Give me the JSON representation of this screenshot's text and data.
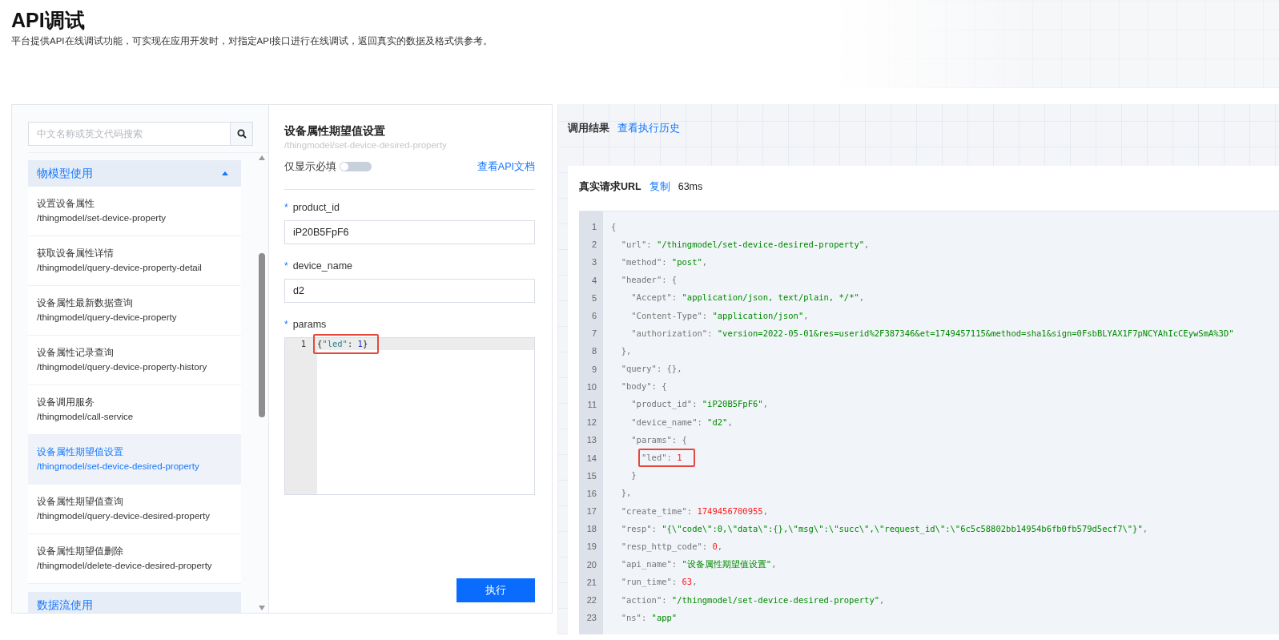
{
  "header": {
    "title": "API调试",
    "description": "平台提供API在线调试功能，可实现在应用开发时，对指定API接口进行在线调试，返回真实的数据及格式供参考。"
  },
  "sidebar": {
    "search": {
      "placeholder": "中文名称或英文代码搜索"
    },
    "groups": [
      {
        "label": "物模型使用",
        "expanded": true,
        "items": [
          {
            "name": "设置设备属性",
            "path": "/thingmodel/set-device-property",
            "selected": false
          },
          {
            "name": "获取设备属性详情",
            "path": "/thingmodel/query-device-property-detail",
            "selected": false
          },
          {
            "name": "设备属性最新数据查询",
            "path": "/thingmodel/query-device-property",
            "selected": false
          },
          {
            "name": "设备属性记录查询",
            "path": "/thingmodel/query-device-property-history",
            "selected": false
          },
          {
            "name": "设备调用服务",
            "path": "/thingmodel/call-service",
            "selected": false
          },
          {
            "name": "设备属性期望值设置",
            "path": "/thingmodel/set-device-desired-property",
            "selected": true
          },
          {
            "name": "设备属性期望值查询",
            "path": "/thingmodel/query-device-desired-property",
            "selected": false
          },
          {
            "name": "设备属性期望值删除",
            "path": "/thingmodel/delete-device-desired-property",
            "selected": false
          }
        ]
      },
      {
        "label": "数据流使用"
      }
    ]
  },
  "form": {
    "title": "设备属性期望值设置",
    "path": "/thingmodel/set-device-desired-property",
    "required_only": {
      "label": "仅显示必填",
      "on": false
    },
    "doc_link": "查看API文档",
    "fields": [
      {
        "mark": "*",
        "label": "product_id",
        "value": "iP20B5FpF6"
      },
      {
        "mark": "*",
        "label": "device_name",
        "value": "d2"
      }
    ],
    "params": {
      "mark": "*",
      "label": "params",
      "lines": [
        {
          "number": "1",
          "boxed": true,
          "tokens": [
            {
              "kind": "brace",
              "text": "{"
            },
            {
              "kind": "key",
              "text": "\"led\""
            },
            {
              "kind": "brace",
              "text": ": "
            },
            {
              "kind": "number",
              "text": "1"
            },
            {
              "kind": "brace",
              "text": "}"
            }
          ]
        }
      ]
    },
    "submit": "执行"
  },
  "result": {
    "title": "调用结果",
    "history_link": "查看执行历史",
    "request_url": {
      "label": "真实请求URL",
      "copy": "复制",
      "duration": "63ms"
    },
    "code": {
      "lines": [
        {
          "number": "1",
          "tokens": [
            {
              "kind": "plain",
              "text": "{"
            }
          ]
        },
        {
          "number": "2",
          "tokens": [
            {
              "kind": "plain",
              "text": "  \"url\": "
            },
            {
              "kind": "string",
              "text": "\"/thingmodel/set-device-desired-property\""
            },
            {
              "kind": "plain",
              "text": ","
            }
          ]
        },
        {
          "number": "3",
          "tokens": [
            {
              "kind": "plain",
              "text": "  \"method\": "
            },
            {
              "kind": "string",
              "text": "\"post\""
            },
            {
              "kind": "plain",
              "text": ","
            }
          ]
        },
        {
          "number": "4",
          "tokens": [
            {
              "kind": "plain",
              "text": "  \"header\": {"
            }
          ]
        },
        {
          "number": "5",
          "tokens": [
            {
              "kind": "plain",
              "text": "    \"Accept\": "
            },
            {
              "kind": "string",
              "text": "\"application/json, text/plain, */*\""
            },
            {
              "kind": "plain",
              "text": ","
            }
          ]
        },
        {
          "number": "6",
          "tokens": [
            {
              "kind": "plain",
              "text": "    \"Content-Type\": "
            },
            {
              "kind": "string",
              "text": "\"application/json\""
            },
            {
              "kind": "plain",
              "text": ","
            }
          ]
        },
        {
          "number": "7",
          "tokens": [
            {
              "kind": "plain",
              "text": "    \"authorization\": "
            },
            {
              "kind": "string",
              "text": "\"version=2022-05-01&res=userid%2F387346&et=1749457115&method=sha1&sign=0FsbBLYAX1F7pNCYAhIcCEywSmA%3D\""
            }
          ]
        },
        {
          "number": "8",
          "tokens": [
            {
              "kind": "plain",
              "text": "  },"
            }
          ]
        },
        {
          "number": "9",
          "tokens": [
            {
              "kind": "plain",
              "text": "  \"query\": {},"
            }
          ]
        },
        {
          "number": "10",
          "tokens": [
            {
              "kind": "plain",
              "text": "  \"body\": {"
            }
          ]
        },
        {
          "number": "11",
          "tokens": [
            {
              "kind": "plain",
              "text": "    \"product_id\": "
            },
            {
              "kind": "string",
              "text": "\"iP20B5FpF6\""
            },
            {
              "kind": "plain",
              "text": ","
            }
          ]
        },
        {
          "number": "12",
          "tokens": [
            {
              "kind": "plain",
              "text": "    \"device_name\": "
            },
            {
              "kind": "string",
              "text": "\"d2\""
            },
            {
              "kind": "plain",
              "text": ","
            }
          ]
        },
        {
          "number": "13",
          "tokens": [
            {
              "kind": "plain",
              "text": "    \"params\": {"
            }
          ]
        },
        {
          "number": "14",
          "boxed": true,
          "tokens": [
            {
              "kind": "plain",
              "text": "      \"led\": "
            },
            {
              "kind": "number",
              "text": "1"
            }
          ]
        },
        {
          "number": "15",
          "tokens": [
            {
              "kind": "plain",
              "text": "    }"
            }
          ]
        },
        {
          "number": "16",
          "tokens": [
            {
              "kind": "plain",
              "text": "  },"
            }
          ]
        },
        {
          "number": "17",
          "tokens": [
            {
              "kind": "plain",
              "text": "  \"create_time\": "
            },
            {
              "kind": "number",
              "text": "1749456700955"
            },
            {
              "kind": "plain",
              "text": ","
            }
          ]
        },
        {
          "number": "18",
          "tokens": [
            {
              "kind": "plain",
              "text": "  \"resp\": "
            },
            {
              "kind": "string",
              "text": "\"{\\\"code\\\":0,\\\"data\\\":{},\\\"msg\\\":\\\"succ\\\",\\\"request_id\\\":\\\"6c5c58802bb14954b6fb0fb579d5ecf7\\\"}\""
            },
            {
              "kind": "plain",
              "text": ","
            }
          ]
        },
        {
          "number": "19",
          "tokens": [
            {
              "kind": "plain",
              "text": "  \"resp_http_code\": "
            },
            {
              "kind": "number",
              "text": "0"
            },
            {
              "kind": "plain",
              "text": ","
            }
          ]
        },
        {
          "number": "20",
          "tokens": [
            {
              "kind": "plain",
              "text": "  \"api_name\": "
            },
            {
              "kind": "string",
              "text": "\"设备属性期望值设置\""
            },
            {
              "kind": "plain",
              "text": ","
            }
          ]
        },
        {
          "number": "21",
          "tokens": [
            {
              "kind": "plain",
              "text": "  \"run_time\": "
            },
            {
              "kind": "number",
              "text": "63"
            },
            {
              "kind": "plain",
              "text": ","
            }
          ]
        },
        {
          "number": "22",
          "tokens": [
            {
              "kind": "plain",
              "text": "  \"action\": "
            },
            {
              "kind": "string",
              "text": "\"/thingmodel/set-device-desired-property\""
            },
            {
              "kind": "plain",
              "text": ","
            }
          ]
        },
        {
          "number": "23",
          "tokens": [
            {
              "kind": "plain",
              "text": "  \"ns\": "
            },
            {
              "kind": "string",
              "text": "\"app\""
            }
          ]
        }
      ]
    }
  }
}
